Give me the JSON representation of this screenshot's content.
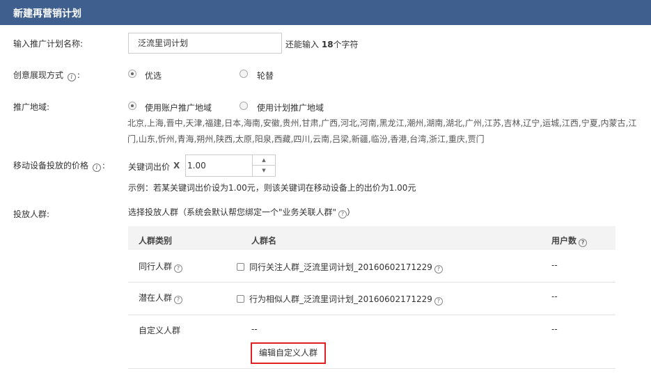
{
  "header": {
    "title": "新建再营销计划"
  },
  "plan_name": {
    "label": "输入推广计划名称:",
    "value": "泛流里词计划",
    "remain_prefix": "还能输入",
    "remain_count": "18",
    "remain_suffix": "个字符"
  },
  "creative": {
    "label": "创意展现方式",
    "colon": ":",
    "options": [
      {
        "label": "优选",
        "checked": true
      },
      {
        "label": "轮替",
        "checked": false
      }
    ]
  },
  "region": {
    "label": "推广地域:",
    "options": [
      {
        "label": "使用账户推广地域",
        "checked": true
      },
      {
        "label": "使用计划推广地域",
        "checked": false
      }
    ],
    "list": "北京,上海,晋中,天津,福建,日本,海南,安徽,贵州,甘肃,广西,河北,河南,黑龙江,潮州,湖南,湖北,广州,江苏,吉林,辽宁,运城,江西,宁夏,内蒙古,江门,山东,忻州,青海,朔州,陕西,太原,阳泉,西藏,四川,云南,吕梁,新疆,临汾,香港,台湾,浙江,重庆,贾门"
  },
  "mobile_price": {
    "label": "移动设备投放的价格",
    "colon": ":",
    "prefix": "关键词出价",
    "multiplier": "X",
    "value": "1.00",
    "example": "示例：若某关键词出价设为1.00元，则该关键词在移动设备上的出价为1.00元"
  },
  "audience": {
    "label": "投放人群:",
    "hint": "选择投放人群（系统会默认帮您绑定一个\"业务关联人群\"",
    "hint_end": "）",
    "columns": {
      "type": "人群类别",
      "name": "人群名",
      "users": "用户数"
    },
    "rows": [
      {
        "type": "同行人群",
        "name": "同行关注人群_泛流里词计划_20160602171229",
        "users": "--"
      },
      {
        "type": "潜在人群",
        "name": "行为相似人群_泛流里词计划_20160602171229",
        "users": "--"
      },
      {
        "type": "自定义人群",
        "name": "--",
        "users": "--"
      }
    ],
    "edit_button": "编辑自定义人群"
  },
  "colors": {
    "header_bg": "#3f5f8f",
    "highlight_border": "#e02020"
  }
}
